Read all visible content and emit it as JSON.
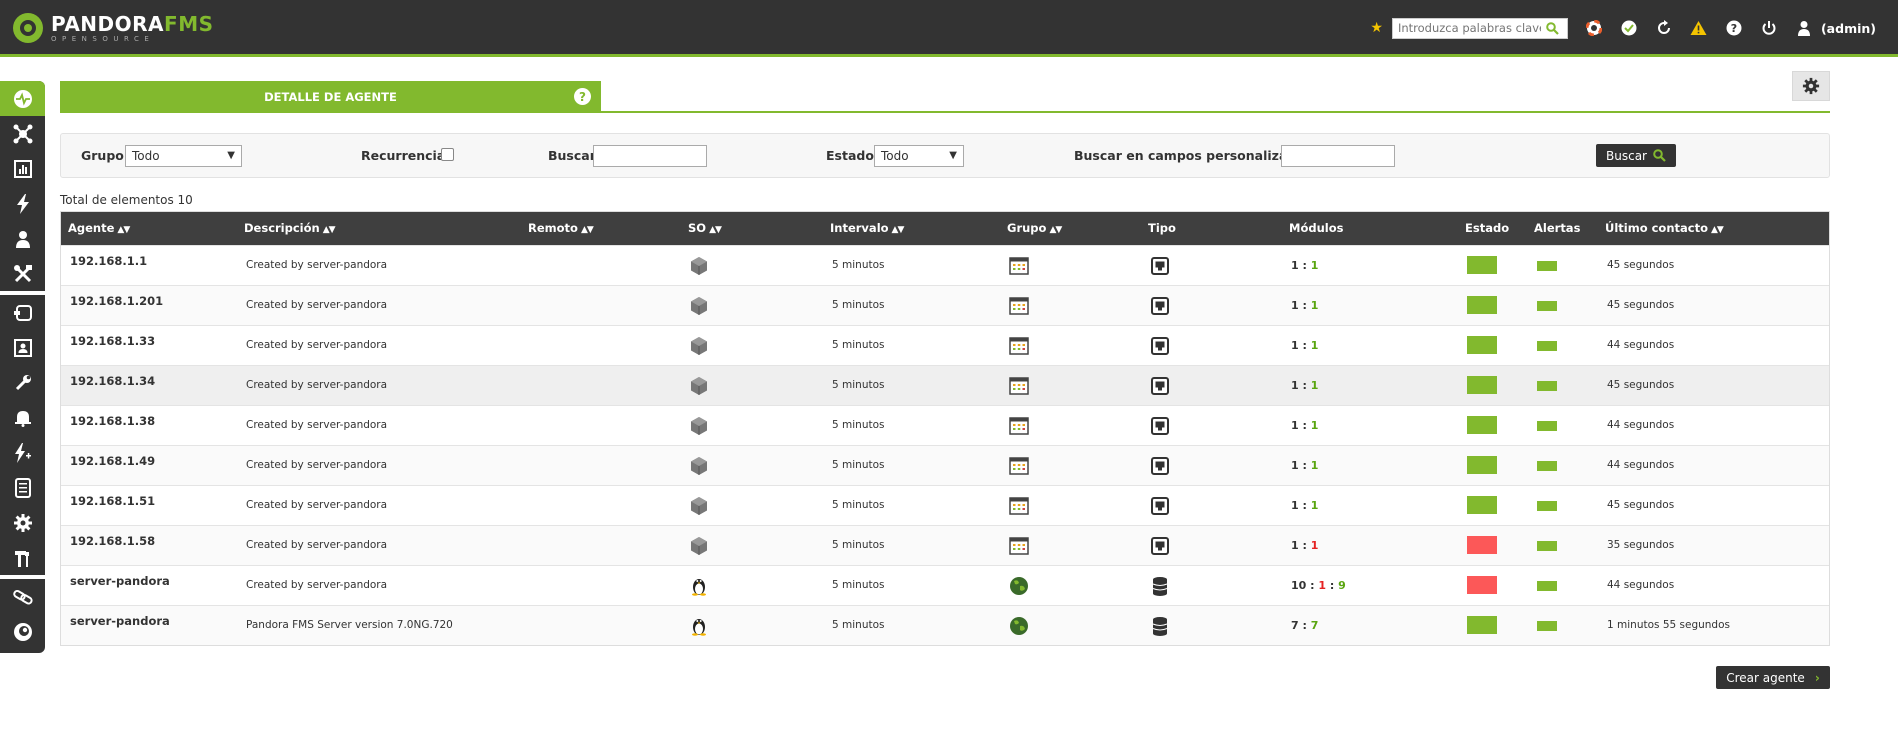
{
  "app": {
    "brand_main": "PANDORA",
    "brand_fms": "FMS",
    "brand_sub": "OPENSOURCE"
  },
  "topbar": {
    "search_placeholder": "Introduzca palabras clave p",
    "user": "(admin)"
  },
  "tab": {
    "title": "DETALLE DE AGENTE",
    "help": "?"
  },
  "filter": {
    "grupo_label": "Grupo",
    "grupo_value": "Todo",
    "recurrencia_label": "Recurrencia",
    "buscar_label": "Buscar",
    "buscar_value": "",
    "estado_label": "Estado",
    "estado_value": "Todo",
    "custom_label": "Buscar en campos personalizados",
    "custom_value": "",
    "button": "Buscar"
  },
  "total_text": "Total de elementos 10",
  "table": {
    "headers": {
      "agente": "Agente",
      "descripcion": "Descripción",
      "remoto": "Remoto",
      "so": "SO",
      "intervalo": "Intervalo",
      "grupo": "Grupo",
      "tipo": "Tipo",
      "modulos": "Módulos",
      "estado": "Estado",
      "alertas": "Alertas",
      "ultimo": "Último contacto"
    },
    "rows": [
      {
        "agent": "192.168.1.1",
        "desc": "Created by server-pandora",
        "os": "other",
        "interval": "5 minutos",
        "group": "applications",
        "type": "network",
        "m1": "1",
        "m2": "1",
        "m2c": "g",
        "m3": "",
        "estado": "#82b92e",
        "last": "45 segundos"
      },
      {
        "agent": "192.168.1.201",
        "desc": "Created by server-pandora",
        "os": "other",
        "interval": "5 minutos",
        "group": "applications",
        "type": "network",
        "m1": "1",
        "m2": "1",
        "m2c": "g",
        "m3": "",
        "estado": "#82b92e",
        "last": "45 segundos"
      },
      {
        "agent": "192.168.1.33",
        "desc": "Created by server-pandora",
        "os": "other",
        "interval": "5 minutos",
        "group": "applications",
        "type": "network",
        "m1": "1",
        "m2": "1",
        "m2c": "g",
        "m3": "",
        "estado": "#82b92e",
        "last": "44 segundos"
      },
      {
        "agent": "192.168.1.34",
        "desc": "Created by server-pandora",
        "os": "other",
        "interval": "5 minutos",
        "group": "applications",
        "type": "network",
        "m1": "1",
        "m2": "1",
        "m2c": "g",
        "m3": "",
        "estado": "#82b92e",
        "last": "45 segundos"
      },
      {
        "agent": "192.168.1.38",
        "desc": "Created by server-pandora",
        "os": "other",
        "interval": "5 minutos",
        "group": "applications",
        "type": "network",
        "m1": "1",
        "m2": "1",
        "m2c": "g",
        "m3": "",
        "estado": "#82b92e",
        "last": "44 segundos"
      },
      {
        "agent": "192.168.1.49",
        "desc": "Created by server-pandora",
        "os": "other",
        "interval": "5 minutos",
        "group": "applications",
        "type": "network",
        "m1": "1",
        "m2": "1",
        "m2c": "g",
        "m3": "",
        "estado": "#82b92e",
        "last": "44 segundos"
      },
      {
        "agent": "192.168.1.51",
        "desc": "Created by server-pandora",
        "os": "other",
        "interval": "5 minutos",
        "group": "applications",
        "type": "network",
        "m1": "1",
        "m2": "1",
        "m2c": "g",
        "m3": "",
        "estado": "#82b92e",
        "last": "45 segundos"
      },
      {
        "agent": "192.168.1.58",
        "desc": "Created by server-pandora",
        "os": "other",
        "interval": "5 minutos",
        "group": "applications",
        "type": "network",
        "m1": "1",
        "m2": "1",
        "m2c": "r",
        "m3": "",
        "estado": "#fc5858",
        "last": "35 segundos"
      },
      {
        "agent": "server-pandora",
        "desc": "Created by server-pandora",
        "os": "linux",
        "interval": "5 minutos",
        "group": "world",
        "type": "server",
        "m1": "10",
        "m2": "1",
        "m2c": "r",
        "m3": "9",
        "estado": "#fc5858",
        "last": "44 segundos"
      },
      {
        "agent": "server-pandora",
        "desc": "Pandora FMS Server version 7.0NG.720",
        "os": "linux",
        "interval": "5 minutos",
        "group": "world",
        "type": "server",
        "m1": "7",
        "m2": "7",
        "m2c": "g",
        "m3": "",
        "estado": "#82b92e",
        "last": "1 minutos 55 segundos"
      }
    ]
  },
  "create_button": "Crear agente",
  "colors": {
    "accent": "#82b92e",
    "dark": "#333333",
    "critical": "#fc5858"
  }
}
